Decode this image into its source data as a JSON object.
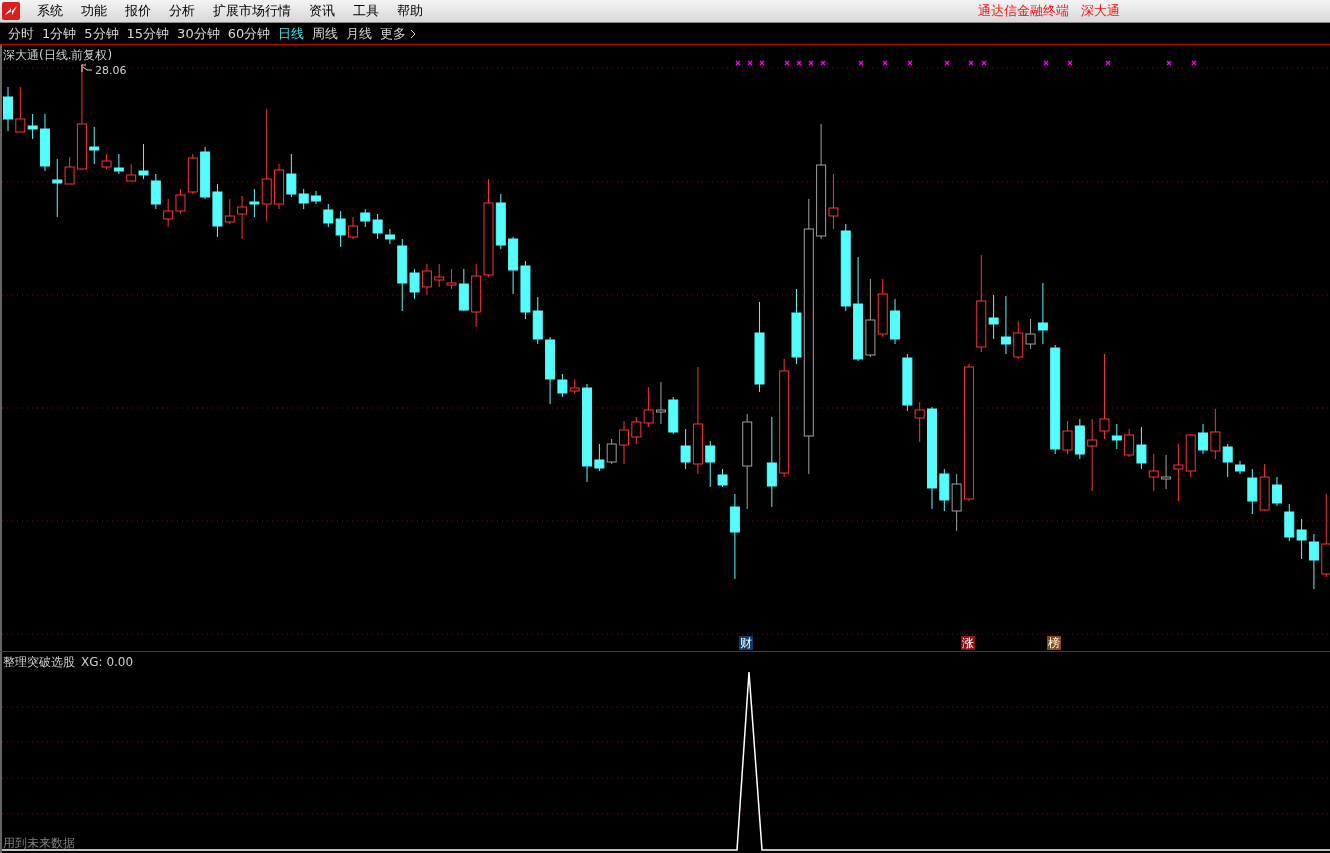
{
  "menu_bar": {
    "items": [
      "系统",
      "功能",
      "报价",
      "分析",
      "扩展市场行情",
      "资讯",
      "工具",
      "帮助"
    ],
    "app_title": "通达信金融终端",
    "stock_name": "深大通"
  },
  "period_tabs": [
    {
      "label": "分时",
      "selected": false
    },
    {
      "label": "1分钟",
      "selected": false
    },
    {
      "label": "5分钟",
      "selected": false
    },
    {
      "label": "15分钟",
      "selected": false
    },
    {
      "label": "30分钟",
      "selected": false
    },
    {
      "label": "60分钟",
      "selected": false
    },
    {
      "label": "日线",
      "selected": true
    },
    {
      "label": "周线",
      "selected": false
    },
    {
      "label": "月线",
      "selected": false
    }
  ],
  "more_button": {
    "label": "更多"
  },
  "main_chart": {
    "title": "深大通(日线.前复权)",
    "high_label": "28.06",
    "signal_badges": [
      {
        "label": "财",
        "color": "#0d3b6e"
      },
      {
        "label": "涨",
        "color": "#8e1010"
      },
      {
        "label": "榜",
        "color": "#8a4a0c"
      }
    ]
  },
  "indicator_panel": {
    "name": "整理突破选股",
    "value": "XG: 0.00",
    "note": "用到未来数据"
  }
}
